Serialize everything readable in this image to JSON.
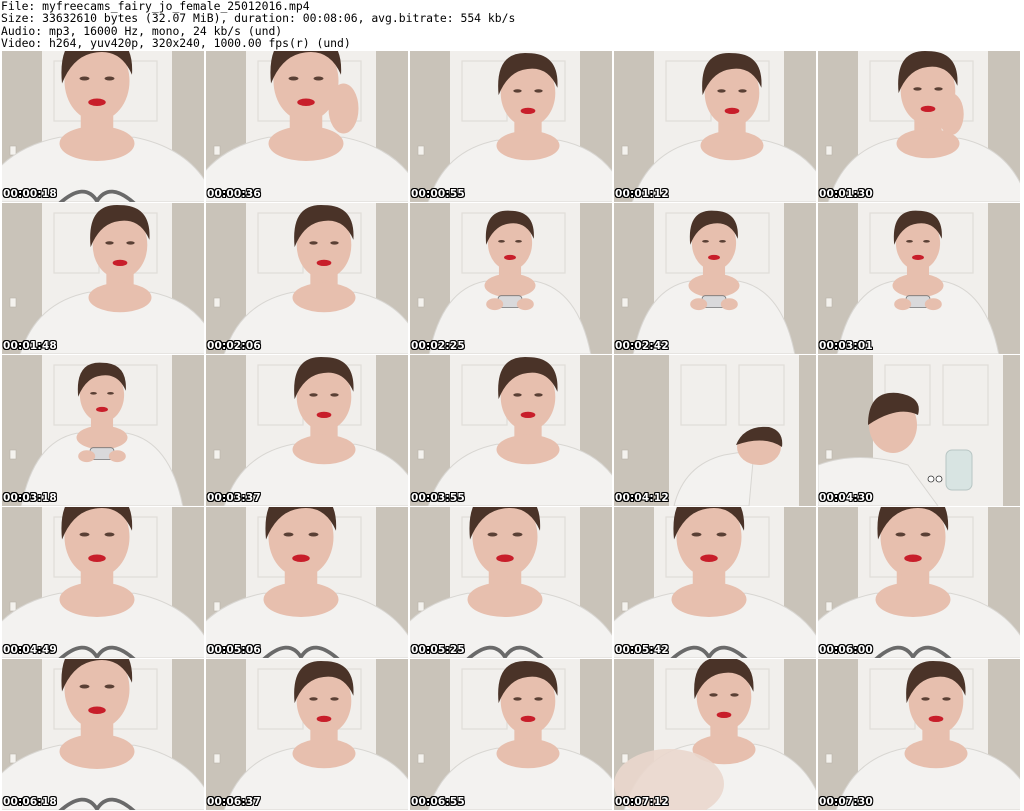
{
  "info": {
    "file": "File: myfreecams_fairy_jo_female_25012016.mp4",
    "size": "Size: 33632610 bytes (32.07 MiB), duration: 00:08:06, avg.bitrate: 554 kb/s",
    "audio": "Audio: mp3, 16000 Hz, mono, 24 kb/s (und)",
    "video": "Video: h264, yuv420p, 320x240, 1000.00 fps(r) (und)"
  },
  "frames": [
    {
      "timestamp": "00:00:18",
      "scene": "closeup"
    },
    {
      "timestamp": "00:00:36",
      "scene": "closeup-hand"
    },
    {
      "timestamp": "00:00:55",
      "scene": "face"
    },
    {
      "timestamp": "00:01:12",
      "scene": "face"
    },
    {
      "timestamp": "00:01:30",
      "scene": "face-hand"
    },
    {
      "timestamp": "00:01:48",
      "scene": "face"
    },
    {
      "timestamp": "00:02:06",
      "scene": "face"
    },
    {
      "timestamp": "00:02:25",
      "scene": "phone"
    },
    {
      "timestamp": "00:02:42",
      "scene": "phone"
    },
    {
      "timestamp": "00:03:01",
      "scene": "phone"
    },
    {
      "timestamp": "00:03:18",
      "scene": "phone"
    },
    {
      "timestamp": "00:03:37",
      "scene": "face"
    },
    {
      "timestamp": "00:03:55",
      "scene": "face"
    },
    {
      "timestamp": "00:04:12",
      "scene": "leaning"
    },
    {
      "timestamp": "00:04:30",
      "scene": "side"
    },
    {
      "timestamp": "00:04:49",
      "scene": "closeup"
    },
    {
      "timestamp": "00:05:06",
      "scene": "closeup"
    },
    {
      "timestamp": "00:05:25",
      "scene": "closeup"
    },
    {
      "timestamp": "00:05:42",
      "scene": "closeup"
    },
    {
      "timestamp": "00:06:00",
      "scene": "closeup"
    },
    {
      "timestamp": "00:06:18",
      "scene": "closeup"
    },
    {
      "timestamp": "00:06:37",
      "scene": "face"
    },
    {
      "timestamp": "00:06:55",
      "scene": "face"
    },
    {
      "timestamp": "00:07:12",
      "scene": "blur"
    },
    {
      "timestamp": "00:07:30",
      "scene": "face"
    }
  ],
  "colors": {
    "wall": "#c9c3b9",
    "door": "#f1efec",
    "skin": "#e7bfae",
    "hair": "#4a3328",
    "lips": "#c81e2a",
    "shirt": "#f3f2f0",
    "timestamp": "#ffffff"
  }
}
